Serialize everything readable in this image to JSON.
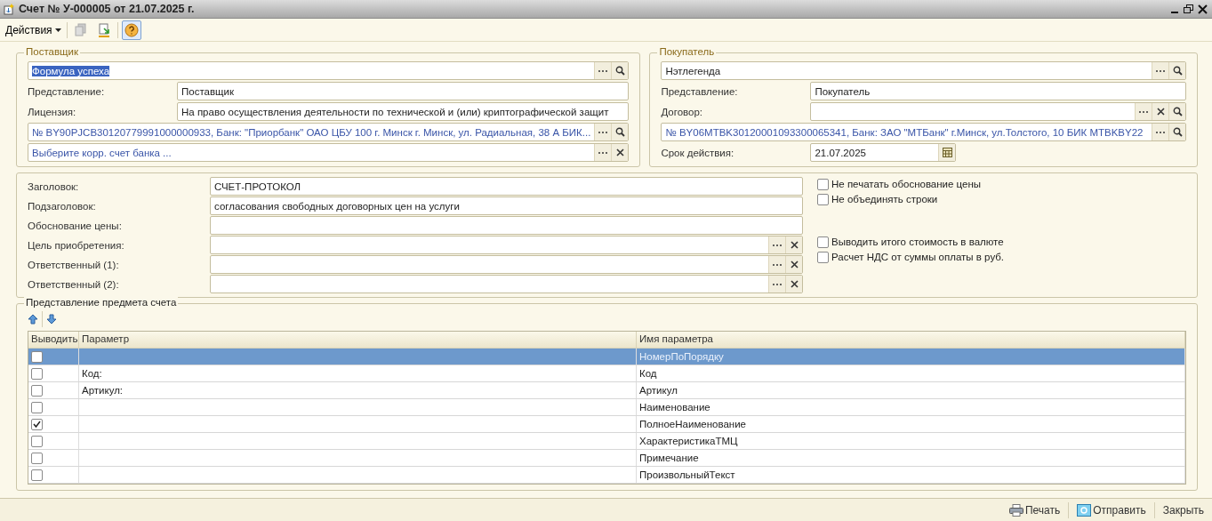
{
  "window": {
    "title": "Счет № У-000005 от 21.07.2025 г."
  },
  "toolbar": {
    "actions_label": "Действия",
    "help_active": true
  },
  "supplier": {
    "title": "Поставщик",
    "rows": [
      {
        "kind": "ref",
        "value": "Формула успеха",
        "text_selected": true,
        "buttons": [
          {
            "kind": "choose"
          },
          {
            "kind": "search"
          }
        ]
      },
      {
        "kind": "field",
        "label": "Представление:",
        "value": "Поставщик"
      },
      {
        "kind": "field",
        "label": "Лицензия:",
        "value": "На право осуществления деятельности по технической и (или) криптографической защит"
      },
      {
        "kind": "account",
        "value": "№ BY90PJCB30120779991000000933, Банк: \"Приорбанк\" ОАО ЦБУ 100 г. Минск г. Минск, ул. Радиальная, 38 А БИК...",
        "buttons": [
          {
            "kind": "choose"
          },
          {
            "kind": "search"
          }
        ]
      },
      {
        "kind": "account",
        "placeholder": "Выберите корр. счет банка ...",
        "buttons": [
          {
            "kind": "choose"
          },
          {
            "kind": "clear"
          }
        ]
      }
    ]
  },
  "buyer": {
    "title": "Покупатель",
    "rows": [
      {
        "kind": "ref",
        "value": "Нэтлегенда",
        "text_selected": false,
        "buttons": [
          {
            "kind": "choose"
          },
          {
            "kind": "search"
          }
        ]
      },
      {
        "kind": "field",
        "label": "Представление:",
        "value": "Покупатель"
      },
      {
        "kind": "field",
        "label": "Договор:",
        "buttons": [
          {
            "kind": "choose"
          },
          {
            "kind": "clear"
          },
          {
            "kind": "search"
          }
        ]
      },
      {
        "kind": "account",
        "value": "№ BY06MTBK30120001093300065341, Банк: ЗАО \"МТБанк\" г.Минск, ул.Толстого, 10 БИК MTBKBY22",
        "buttons": [
          {
            "kind": "choose"
          },
          {
            "kind": "search"
          }
        ]
      },
      {
        "kind": "date",
        "label": "Срок действия:",
        "value": "21.07.2025"
      }
    ]
  },
  "print_settings": {
    "fields": [
      {
        "label": "Заголовок:",
        "value": "СЧЕТ-ПРОТОКОЛ"
      },
      {
        "label": "Подзаголовок:",
        "value": "согласования свободных договорных цен на услуги"
      },
      {
        "label": "Обоснование цены:"
      },
      {
        "label": "Цель приобретения:",
        "buttons": [
          {
            "kind": "choose"
          },
          {
            "kind": "clear"
          }
        ]
      },
      {
        "label": "Ответственный (1):",
        "buttons": [
          {
            "kind": "choose"
          },
          {
            "kind": "clear"
          }
        ]
      },
      {
        "label": "Ответственный (2):",
        "buttons": [
          {
            "kind": "choose"
          },
          {
            "kind": "clear"
          }
        ]
      }
    ],
    "options_top": [
      {
        "label": "Не печатать обоснование цены",
        "checked": false
      },
      {
        "label": "Не объединять строки",
        "checked": false
      }
    ],
    "options_bottom": [
      {
        "label": "Выводить итого стоимость в валюте",
        "checked": false
      },
      {
        "label": "Расчет НДС от суммы оплаты в руб.",
        "checked": false
      }
    ]
  },
  "subject": {
    "title": "Представление предмета счета",
    "columns": [
      "Выводить",
      "Параметр",
      "Имя параметра"
    ],
    "rows": [
      {
        "checked": false,
        "parameter": "",
        "name": "НомерПоПорядку",
        "selected": true
      },
      {
        "checked": false,
        "parameter": "Код:",
        "name": "Код",
        "selected": false
      },
      {
        "checked": false,
        "parameter": "Артикул:",
        "name": "Артикул",
        "selected": false
      },
      {
        "checked": false,
        "parameter": "",
        "name": "Наименование",
        "selected": false
      },
      {
        "checked": true,
        "parameter": "",
        "name": "ПолноеНаименование",
        "selected": false
      },
      {
        "checked": false,
        "parameter": "",
        "name": "ХарактеристикаТМЦ",
        "selected": false
      },
      {
        "checked": false,
        "parameter": "",
        "name": "Примечание",
        "selected": false
      },
      {
        "checked": false,
        "parameter": "",
        "name": "ПроизвольныйТекст",
        "selected": false
      }
    ]
  },
  "footer": {
    "buttons": [
      {
        "kind": "print",
        "label": "Печать"
      },
      {
        "kind": "send",
        "label": "Отправить"
      },
      {
        "kind": "close",
        "label": "Закрыть"
      }
    ]
  }
}
